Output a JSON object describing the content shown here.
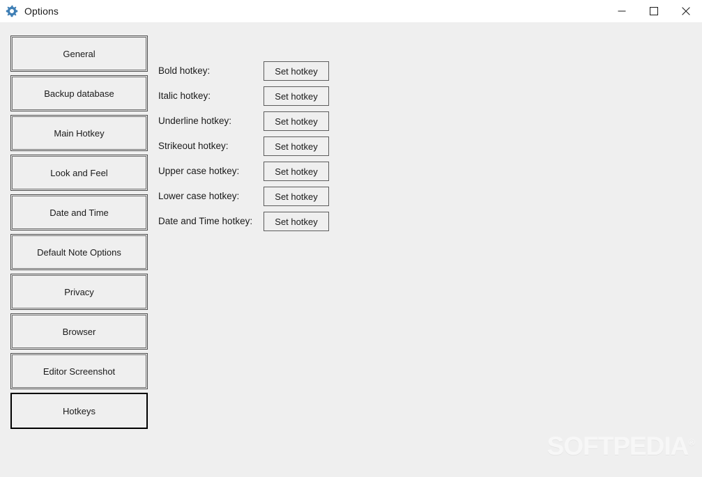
{
  "window": {
    "title": "Options",
    "icon": "gear-icon",
    "background_color": "#efefef",
    "titlebar_color": "#ffffff",
    "accent_color": "#3f7fb5"
  },
  "titlebar_buttons": [
    {
      "name": "minimize",
      "glyph": "minimize-icon",
      "label": "Minimize"
    },
    {
      "name": "maximize",
      "glyph": "maximize-icon",
      "label": "Maximize"
    },
    {
      "name": "close",
      "glyph": "close-icon",
      "label": "Close"
    }
  ],
  "sidebar": {
    "items": [
      {
        "label": "General",
        "active": false
      },
      {
        "label": "Backup database",
        "active": false
      },
      {
        "label": "Main Hotkey",
        "active": false
      },
      {
        "label": "Look and Feel",
        "active": false
      },
      {
        "label": "Date and Time",
        "active": false
      },
      {
        "label": "Default Note Options",
        "active": false
      },
      {
        "label": "Privacy",
        "active": false
      },
      {
        "label": "Browser",
        "active": false
      },
      {
        "label": "Editor Screenshot",
        "active": false
      },
      {
        "label": "Hotkeys",
        "active": true
      }
    ]
  },
  "main": {
    "button_label": "Set hotkey",
    "rows": [
      {
        "label": "Bold hotkey:",
        "button": "Set hotkey"
      },
      {
        "label": "Italic hotkey:",
        "button": "Set hotkey"
      },
      {
        "label": "Underline hotkey:",
        "button": "Set hotkey"
      },
      {
        "label": "Strikeout hotkey:",
        "button": "Set hotkey"
      },
      {
        "label": "Upper case hotkey:",
        "button": "Set hotkey"
      },
      {
        "label": "Lower case hotkey:",
        "button": "Set hotkey"
      },
      {
        "label": "Date and Time hotkey:",
        "button": "Set hotkey"
      }
    ]
  },
  "watermark": {
    "text": "SOFTPEDIA",
    "mark": "®"
  }
}
